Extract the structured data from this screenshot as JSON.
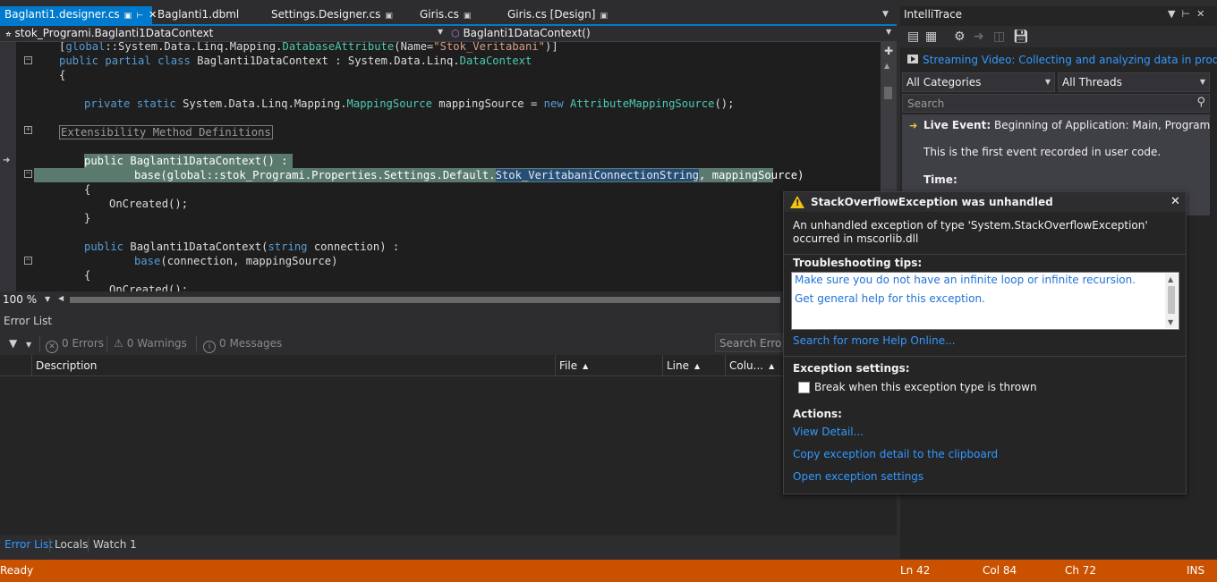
{
  "tabs": [
    {
      "label": "Baglanti1.designer.cs",
      "active": true
    },
    {
      "label": "Baglanti1.dbml"
    },
    {
      "label": "Settings.Designer.cs"
    },
    {
      "label": "Giris.cs"
    },
    {
      "label": "Giris.cs [Design]"
    }
  ],
  "navbar": {
    "class_scope": "stok_Programi.Baglanti1DataContext",
    "member_scope": "Baglanti1DataContext()"
  },
  "code": {
    "line0": {
      "a": "[",
      "b": "global",
      "c": "::System.Data.Linq.Mapping.",
      "d": "DatabaseAttribute",
      "e": "(Name=",
      "f": "\"Stok_Veritabani\"",
      "g": ")]"
    },
    "line1": {
      "a": "public",
      "b": "partial",
      "c": "class",
      "d": "Baglanti1DataContext : System.Data.Linq.",
      "e": "DataContext"
    },
    "line2": "{",
    "line3": {
      "a": "private",
      "b": "static",
      "c": "System.Data.Linq.Mapping.",
      "d": "MappingSource",
      "e": " mappingSource = ",
      "f": "new",
      "g": "AttributeMappingSource",
      "h": "();"
    },
    "region": "Extensibility Method Definitions",
    "line5": "public Baglanti1DataContext() :",
    "line6": {
      "a": "base(global::stok_Programi.Properties.Settings.Default.",
      "b": "Stok_VeritabaniConnectionString",
      "c": ", mappingSource)"
    },
    "line7": "{",
    "line8": "OnCreated();",
    "line9": "}",
    "line10": {
      "a": "public",
      "b": "Baglanti1DataContext(",
      "c": "string",
      "d": "connection) :"
    },
    "line11": {
      "a": "base",
      "b": "(connection, mappingSource)"
    },
    "line12": "{",
    "line13": "OnCreated();"
  },
  "zoom": {
    "value": "100 %"
  },
  "error_list": {
    "title": "Error List",
    "errors": "0 Errors",
    "warnings": "0 Warnings",
    "messages": "0 Messages",
    "search_placeholder": "Search Error List",
    "columns": {
      "description": "Description",
      "file": "File",
      "line": "Line",
      "column": "Colu..."
    }
  },
  "bottom_tabs": [
    {
      "label": "Error List",
      "active": true
    },
    {
      "label": "Locals"
    },
    {
      "label": "Watch 1"
    }
  ],
  "intellitrace": {
    "title": "IntelliTrace",
    "streaming_link": "Streaming Video: Collecting and analyzing data in production",
    "category_filter": "All Categories",
    "thread_filter": "All Threads",
    "search_placeholder": "Search",
    "event": {
      "title_bold": "Live Event:",
      "title_rest": " Beginning of Application: Main, Program.cs",
      "description": "This is the first event recorded in user code.",
      "time_label": "Time:"
    }
  },
  "exception": {
    "title": "StackOverflowException was unhandled",
    "message": "An unhandled exception of type 'System.StackOverflowException' occurred in mscorlib.dll",
    "tips_heading": "Troubleshooting tips:",
    "tips": [
      "Make sure you do not have an infinite loop or infinite recursion.",
      "Get general help for this exception."
    ],
    "search_help": "Search for more Help Online...",
    "settings_heading": "Exception settings:",
    "break_checkbox_label": "Break when this exception type is thrown",
    "break_checked": false,
    "actions_heading": "Actions:",
    "actions": [
      "View Detail...",
      "Copy exception detail to the clipboard",
      "Open exception settings"
    ]
  },
  "status": {
    "text": "Ready",
    "ln": "Ln 42",
    "col": "Col 84",
    "ch": "Ch 72",
    "mode": "INS"
  },
  "colors": {
    "accent": "#007acc",
    "status_bar": "#ca5100",
    "link": "#3399ff",
    "keyword": "#569cd6",
    "type": "#4ec9b0",
    "string": "#d69d85"
  }
}
